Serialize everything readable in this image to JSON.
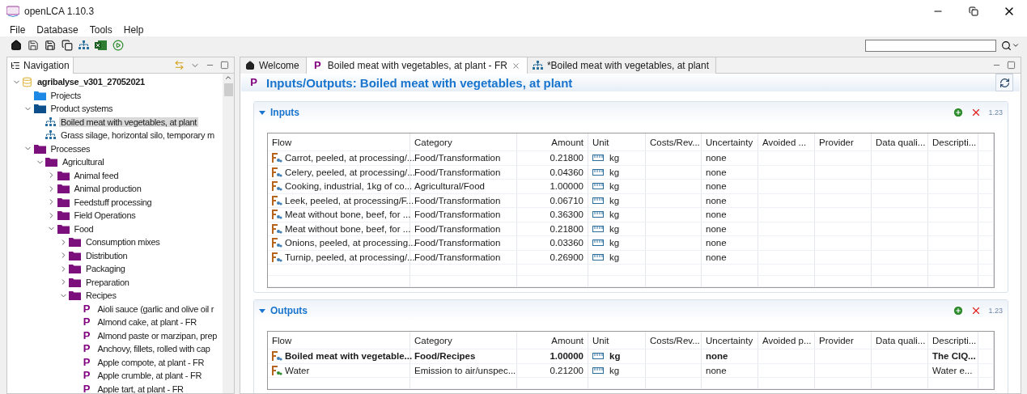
{
  "window": {
    "title": "openLCA 1.10.3"
  },
  "menu": [
    "File",
    "Database",
    "Tools",
    "Help"
  ],
  "navigation": {
    "title": "Navigation",
    "tree": [
      {
        "label": "agribalyse_v301_27052021",
        "kind": "database",
        "expanded": true,
        "selected": false,
        "children": [
          {
            "label": "Projects",
            "kind": "folder",
            "color": "#1e88e5",
            "selected": false
          },
          {
            "label": "Product systems",
            "kind": "folder",
            "color": "#0d4f8b",
            "expanded": true,
            "selected": false,
            "children": [
              {
                "label": "Boiled meat with vegetables, at plant",
                "kind": "system",
                "selected": true
              },
              {
                "label": "Grass silage, horizontal silo, temporary m",
                "kind": "system",
                "selected": false
              }
            ]
          },
          {
            "label": "Processes",
            "kind": "folder",
            "color": "#7b0f7b",
            "expanded": true,
            "selected": false,
            "children": [
              {
                "label": "Agricultural",
                "kind": "folder",
                "color": "#7b0f7b",
                "expanded": true,
                "selected": false,
                "children": [
                  {
                    "label": "Animal feed",
                    "kind": "folder",
                    "color": "#7b0f7b",
                    "expanded": false,
                    "selected": false
                  },
                  {
                    "label": "Animal production",
                    "kind": "folder",
                    "color": "#7b0f7b",
                    "expanded": false,
                    "selected": false
                  },
                  {
                    "label": "Feedstuff processing",
                    "kind": "folder",
                    "color": "#7b0f7b",
                    "expanded": false,
                    "selected": false
                  },
                  {
                    "label": "Field Operations",
                    "kind": "folder",
                    "color": "#7b0f7b",
                    "expanded": false,
                    "selected": false
                  },
                  {
                    "label": "Food",
                    "kind": "folder",
                    "color": "#7b0f7b",
                    "expanded": true,
                    "selected": false,
                    "children": [
                      {
                        "label": "Consumption mixes",
                        "kind": "folder",
                        "color": "#7b0f7b",
                        "expanded": false,
                        "selected": false
                      },
                      {
                        "label": "Distribution",
                        "kind": "folder",
                        "color": "#7b0f7b",
                        "expanded": false,
                        "selected": false
                      },
                      {
                        "label": "Packaging",
                        "kind": "folder",
                        "color": "#7b0f7b",
                        "expanded": false,
                        "selected": false
                      },
                      {
                        "label": "Preparation",
                        "kind": "folder",
                        "color": "#7b0f7b",
                        "expanded": false,
                        "selected": false
                      },
                      {
                        "label": "Recipes",
                        "kind": "folder",
                        "color": "#7b0f7b",
                        "expanded": true,
                        "selected": false,
                        "children": [
                          {
                            "label": "Aioli sauce (garlic and olive oil r",
                            "kind": "process",
                            "letter": "P",
                            "selected": false
                          },
                          {
                            "label": "Almond cake, at plant - FR",
                            "kind": "process",
                            "letter": "P",
                            "selected": false
                          },
                          {
                            "label": "Almond paste or marzipan, prep",
                            "kind": "process",
                            "letter": "P",
                            "selected": false
                          },
                          {
                            "label": "Anchovy, fillets, rolled with cap",
                            "kind": "process",
                            "letter": "P",
                            "selected": false
                          },
                          {
                            "label": "Apple compote, at plant - FR",
                            "kind": "process",
                            "letter": "P",
                            "selected": false
                          },
                          {
                            "label": "Apple crumble, at plant - FR",
                            "kind": "process",
                            "letter": "P",
                            "selected": false
                          },
                          {
                            "label": "Apple tart, at plant - FR",
                            "kind": "process",
                            "letter": "P",
                            "selected": false
                          }
                        ]
                      }
                    ]
                  }
                ]
              }
            ]
          }
        ]
      }
    ]
  },
  "editor": {
    "tabs": [
      {
        "label": "Welcome",
        "kind": "home",
        "selected": false
      },
      {
        "label": "Boiled meat with vegetables, at plant - FR",
        "kind": "process",
        "letter": "P",
        "selected": true,
        "closable": true
      },
      {
        "label": "*Boiled meat with vegetables, at plant",
        "kind": "system",
        "selected": false
      }
    ],
    "title_letter": "P",
    "title": "Inputs/Outputs: Boiled meat with vegetables, at plant",
    "sections": [
      {
        "title": "Inputs",
        "expanded": true,
        "format_label": "1.23",
        "columns": [
          "Flow",
          "Category",
          "Amount",
          "Unit",
          "Costs/Rev...",
          "Uncertainty",
          "Avoided ...",
          "Provider",
          "Data quali...",
          "Descripti..."
        ],
        "rows": [
          {
            "flow": "Carrot, peeled, at processing/...",
            "kind": "product",
            "reference": false,
            "category": "Food/Transformation",
            "amount": "0.21800",
            "unit": "kg",
            "uncertainty": "none"
          },
          {
            "flow": "Celery, peeled, at processing/...",
            "kind": "product",
            "reference": false,
            "category": "Food/Transformation",
            "amount": "0.04360",
            "unit": "kg",
            "uncertainty": "none"
          },
          {
            "flow": "Cooking, industrial, 1kg of co...",
            "kind": "product",
            "reference": false,
            "category": "Agricultural/Food",
            "amount": "1.00000",
            "unit": "kg",
            "uncertainty": "none"
          },
          {
            "flow": "Leek, peeled, at processing/F...",
            "kind": "product",
            "reference": false,
            "category": "Food/Transformation",
            "amount": "0.06710",
            "unit": "kg",
            "uncertainty": "none"
          },
          {
            "flow": "Meat without bone, beef, for ...",
            "kind": "product",
            "reference": false,
            "category": "Food/Transformation",
            "amount": "0.36300",
            "unit": "kg",
            "uncertainty": "none"
          },
          {
            "flow": "Meat without bone, beef, for ...",
            "kind": "product",
            "reference": false,
            "category": "Food/Transformation",
            "amount": "0.21800",
            "unit": "kg",
            "uncertainty": "none"
          },
          {
            "flow": "Onions, peeled, at processing...",
            "kind": "product",
            "reference": false,
            "category": "Food/Transformation",
            "amount": "0.03360",
            "unit": "kg",
            "uncertainty": "none"
          },
          {
            "flow": "Turnip, peeled, at processing/...",
            "kind": "product",
            "reference": false,
            "category": "Food/Transformation",
            "amount": "0.26900",
            "unit": "kg",
            "uncertainty": "none"
          }
        ]
      },
      {
        "title": "Outputs",
        "expanded": true,
        "format_label": "1.23",
        "columns": [
          "Flow",
          "Category",
          "Amount",
          "Unit",
          "Costs/Rev...",
          "Uncertainty",
          "Avoided p...",
          "Provider",
          "Data quali...",
          "Descripti..."
        ],
        "rows": [
          {
            "flow": "Boiled meat with vegetable...",
            "kind": "product",
            "reference": true,
            "category": "Food/Recipes",
            "amount": "1.00000",
            "unit": "kg",
            "uncertainty": "none",
            "description": "The CIQ..."
          },
          {
            "flow": "Water",
            "kind": "elementary",
            "reference": false,
            "category": "Emission to air/unspec...",
            "amount": "0.21200",
            "unit": "kg",
            "uncertainty": "none",
            "description": "Water e..."
          }
        ]
      }
    ]
  }
}
